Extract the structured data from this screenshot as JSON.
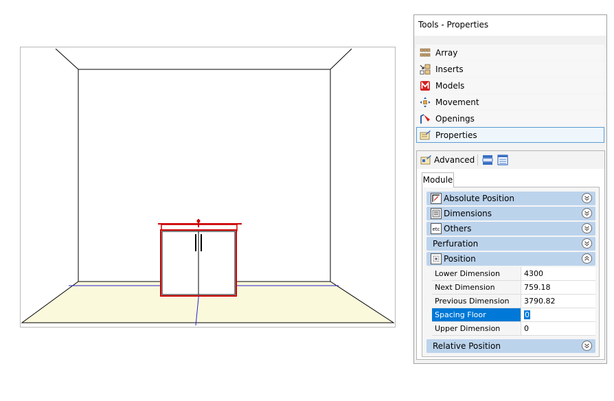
{
  "panel": {
    "title": "Tools - Properties",
    "tools": [
      {
        "label": "Array",
        "icon": "array-icon"
      },
      {
        "label": "Inserts",
        "icon": "inserts-icon"
      },
      {
        "label": "Models",
        "icon": "models-icon"
      },
      {
        "label": "Movement",
        "icon": "movement-icon"
      },
      {
        "label": "Openings",
        "icon": "openings-icon"
      },
      {
        "label": "Properties",
        "icon": "properties-icon",
        "selected": true
      }
    ]
  },
  "properties": {
    "toolbar": {
      "advanced_label": "Advanced"
    },
    "tab": "Module",
    "categories": {
      "absolute_position": "Absolute Position",
      "dimensions": "Dimensions",
      "others": "Others",
      "perfuration": "Perfuration",
      "position": "Position",
      "relative_position": "Relative Position"
    },
    "position_rows": [
      {
        "name": "Lower Dimension",
        "value": "4300"
      },
      {
        "name": "Next Dimension",
        "value": "759.18"
      },
      {
        "name": "Previous Dimension",
        "value": "3790.82"
      },
      {
        "name": "Spacing Floor",
        "value": "0",
        "selected": true
      },
      {
        "name": "Upper Dimension",
        "value": "0"
      }
    ],
    "others_icon_text": "etc"
  },
  "colors": {
    "accent": "#0078d7",
    "category_header": "#bcd3ec",
    "floor": "#fbf9dc",
    "cabinet_outline": "#cc0000",
    "axis_blue": "#2020cc"
  }
}
